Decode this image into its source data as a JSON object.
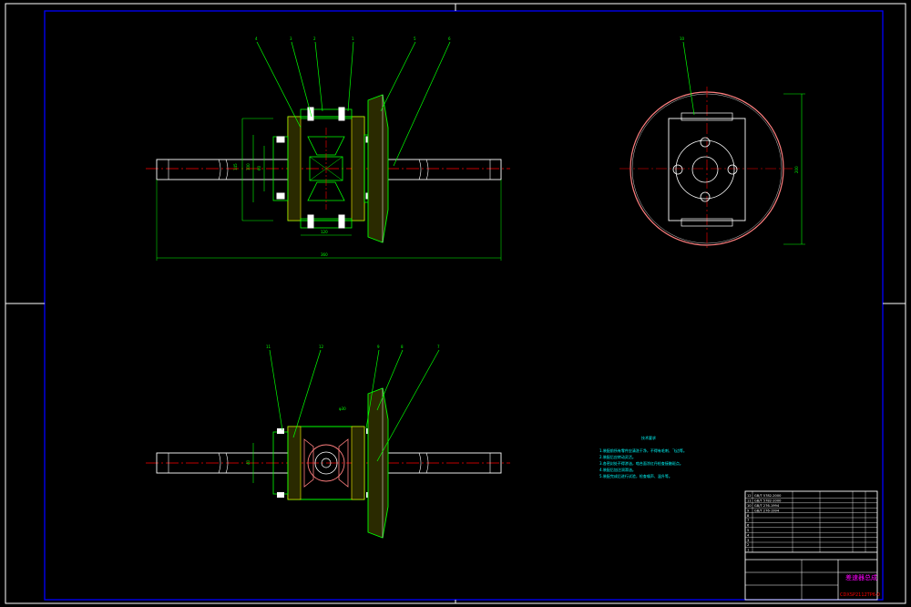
{
  "sheet": {
    "background": "#000000",
    "colors": {
      "frame": "#ffffff",
      "outline": "#00ff00",
      "hidden": "#ffff00",
      "dimension": "#00ff00",
      "centerline": "#ff0000",
      "hatch": "#ffff00",
      "notes": "#00ffff",
      "title_magenta": "#ff00ff",
      "title_red": "#ff0000",
      "bolts": "#ffffff"
    }
  },
  "views": {
    "front": {
      "balloons": [
        "4",
        "3",
        "2",
        "1",
        "5",
        "6"
      ],
      "dim_overall": "360",
      "dim_case": "120",
      "dim_left_1": "145",
      "dim_left_2": "100",
      "dim_left_3": "60"
    },
    "side": {
      "balloons": [
        "10"
      ],
      "dim_height": "200"
    },
    "bottom": {
      "balloons": [
        "11",
        "12",
        "9",
        "8",
        "7"
      ],
      "dim_left": "40",
      "label_gear": "φ30"
    }
  },
  "notes": {
    "title": "技术要求",
    "lines": [
      "1.装配前所有零件应清洗干净，不得有毛刺、飞边等。",
      "2.装配后应转动灵活。",
      "3.各密封处不得渗油，啮合面涂红丹检查接触斑点。",
      "4.装配后加注润滑油。",
      "5.装配完成后进行试验，检查噪声、温升等。"
    ]
  },
  "title_block": {
    "drawing_name": "差速器总成",
    "drawing_code": "CDXSP2112TP6-0",
    "parts": [
      {
        "no": "12",
        "name": "GB/T 5782-2000",
        "mat": "",
        "qty": "",
        "note": ""
      },
      {
        "no": "11",
        "name": "GB/T 5782-2000",
        "mat": "",
        "qty": "",
        "note": ""
      },
      {
        "no": "10",
        "name": "GB/T 276-1994",
        "mat": "",
        "qty": "",
        "note": ""
      },
      {
        "no": "9",
        "name": "GB/T 276-1994",
        "mat": "",
        "qty": "",
        "note": ""
      },
      {
        "no": "8",
        "name": "",
        "mat": "",
        "qty": "",
        "note": ""
      },
      {
        "no": "7",
        "name": "",
        "mat": "",
        "qty": "",
        "note": ""
      },
      {
        "no": "6",
        "name": "",
        "mat": "",
        "qty": "",
        "note": ""
      },
      {
        "no": "5",
        "name": "",
        "mat": "",
        "qty": "",
        "note": ""
      },
      {
        "no": "4",
        "name": "",
        "mat": "",
        "qty": "",
        "note": ""
      },
      {
        "no": "3",
        "name": "",
        "mat": "",
        "qty": "",
        "note": ""
      },
      {
        "no": "2",
        "name": "",
        "mat": "",
        "qty": "",
        "note": ""
      },
      {
        "no": "1",
        "name": "",
        "mat": "",
        "qty": "",
        "note": ""
      }
    ]
  }
}
